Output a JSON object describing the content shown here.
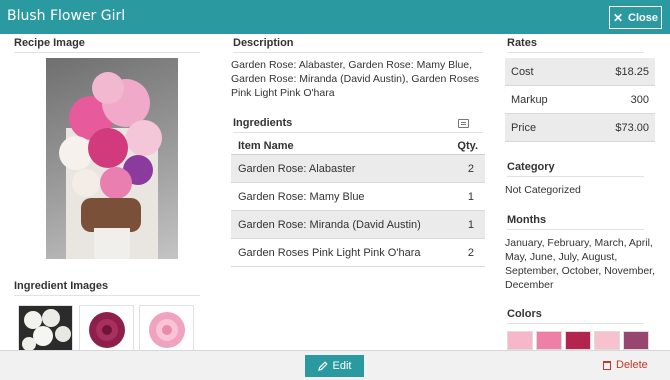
{
  "window": {
    "title": "Blush Flower Girl",
    "close_label": "Close"
  },
  "recipe_image": {
    "heading": "Recipe Image"
  },
  "ingredient_images": {
    "heading": "Ingredient Images"
  },
  "description": {
    "heading": "Description",
    "text": "Garden Rose: Alabaster, Garden Rose: Mamy Blue, Garden Rose: Miranda (David Austin), Garden Roses Pink Light Pink O'hara"
  },
  "ingredients": {
    "heading": "Ingredients",
    "columns": {
      "name": "Item Name",
      "qty": "Qty."
    },
    "rows": [
      {
        "name": "Garden Rose: Alabaster",
        "qty": "2"
      },
      {
        "name": "Garden Rose: Mamy Blue",
        "qty": "1"
      },
      {
        "name": "Garden Rose: Miranda (David Austin)",
        "qty": "1"
      },
      {
        "name": "Garden Roses Pink Light Pink O'hara",
        "qty": "2"
      }
    ]
  },
  "rates": {
    "heading": "Rates",
    "rows": [
      {
        "label": "Cost",
        "value": "$18.25"
      },
      {
        "label": "Markup",
        "value": "300"
      },
      {
        "label": "Price",
        "value": "$73.00"
      }
    ]
  },
  "category": {
    "heading": "Category",
    "value": "Not Categorized"
  },
  "months": {
    "heading": "Months",
    "value": "January, February, March, April, May, June, July, August, September, October, November, December"
  },
  "colors": {
    "heading": "Colors",
    "swatches": [
      "#f6b8c8",
      "#ef7fa6",
      "#b3244e",
      "#f7c1cd",
      "#96466f"
    ]
  },
  "footer": {
    "edit_label": "Edit",
    "delete_label": "Delete"
  },
  "icons": {
    "close": "x-icon",
    "edit": "pencil-icon",
    "delete": "trash-icon",
    "list": "list-icon"
  },
  "theme": {
    "accent": "#2a9aa0",
    "danger": "#c0392b"
  }
}
